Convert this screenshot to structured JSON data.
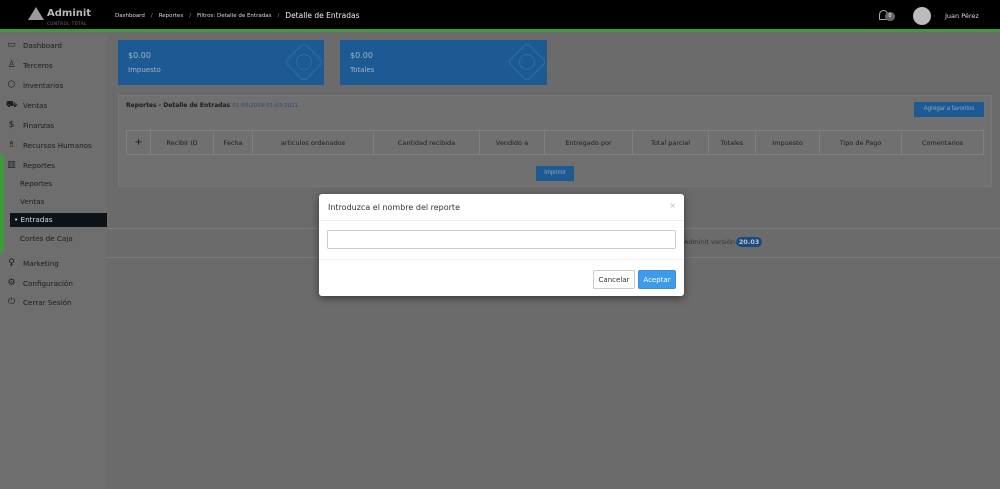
{
  "header": {
    "logo_text": "Adminit",
    "logo_subtext": "CONTROL TOTAL",
    "breadcrumb": [
      "Dashboard",
      "Reportes",
      "Filtros: Detalle de Entradas",
      "Detalle de Entradas"
    ],
    "breadcrumb_separator": "/",
    "notification_count": "0",
    "user_name": "Juan Pérez"
  },
  "sidebar": {
    "items": [
      {
        "label": "Dashboard",
        "icon": "monitor-icon"
      },
      {
        "label": "Terceros",
        "icon": "user-icon"
      },
      {
        "label": "Inventarios",
        "icon": "box-icon"
      },
      {
        "label": "Ventas",
        "icon": "cart-icon"
      },
      {
        "label": "Finanzas",
        "icon": "dollar-icon"
      },
      {
        "label": "Recursos Humanos",
        "icon": "people-icon"
      },
      {
        "label": "Reportes",
        "icon": "bar-chart-icon"
      }
    ],
    "sub_items": [
      "Reportes",
      "Ventas",
      "Entradas",
      "Cortes de Caja"
    ],
    "active_sub_item": "Entradas",
    "items_after": [
      {
        "label": "Marketing",
        "icon": "bulb-icon"
      },
      {
        "label": "Configuración",
        "icon": "gear-icon"
      },
      {
        "label": "Cerrar Sesión",
        "icon": "power-icon"
      }
    ]
  },
  "cards": [
    {
      "amount": "$0.00",
      "label": "Impuesto"
    },
    {
      "amount": "$0.00",
      "label": "Totales"
    }
  ],
  "report": {
    "title": "Reportes - Detalle de Entradas",
    "date_range": "01-03-2019-01-03-2021",
    "favorites_button": "Agregar a favoritos",
    "columns": [
      "+",
      "Recibir ID",
      "Fecha",
      "articulos ordenados",
      "Cantidad recibida",
      "Vendido a",
      "Entregado por",
      "Total parcial",
      "Totales",
      "Impuesto",
      "Tipo de Pago",
      "Comentarios"
    ],
    "print_button": "Imprimir"
  },
  "footer": {
    "version_label": "Adminit versión",
    "version_number": "20.03"
  },
  "modal": {
    "title": "Introduzca el nombre del reporte",
    "close_glyph": "×",
    "input_value": "",
    "cancel_label": "Cancelar",
    "accept_label": "Aceptar"
  },
  "colors": {
    "topbar": "#000000",
    "accent_green": "#3f9a3a",
    "card_blue": "#1d5a93",
    "primary_button": "#3d9be9"
  }
}
